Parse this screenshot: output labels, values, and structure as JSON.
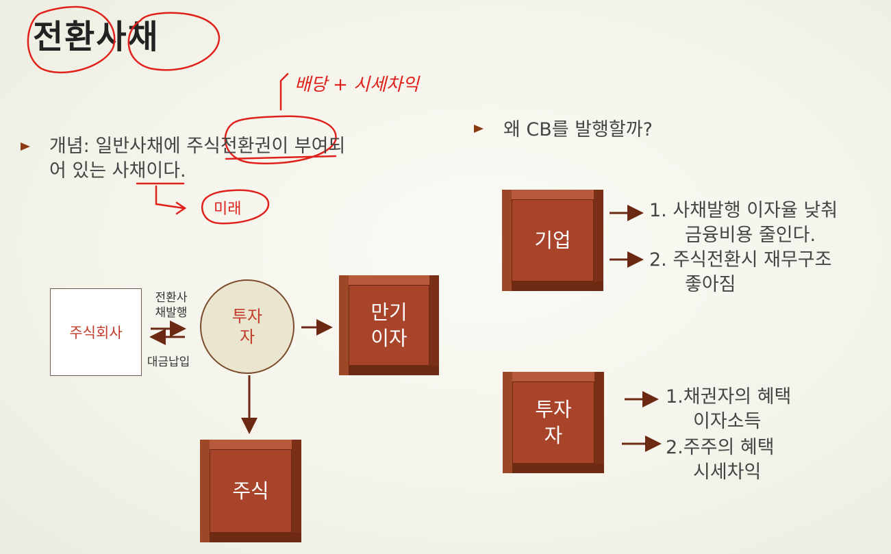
{
  "title": "전환사채",
  "annotations": {
    "top": "배당 + 시세차익",
    "bottom": "미래"
  },
  "left_bullet": {
    "line1": "개념: 일반사채에 주식전환권이 부여되",
    "line2": "어 있는 사채이다."
  },
  "right_bullet": "왜 CB를 발행할까?",
  "diagram": {
    "company": "주식회사",
    "issue_label_1": "전환사",
    "issue_label_2": "채발행",
    "payment_label": "대금납입",
    "investor_1": "투자",
    "investor_2": "자",
    "maturity_1": "만기",
    "maturity_2": "이자",
    "stock": "주식"
  },
  "corporate": {
    "box": "기업",
    "p1_line1": "1.  사채발행 이자율 낮춰",
    "p1_line2": "금융비용 줄인다.",
    "p2_line1": "2.  주식전환시 재무구조",
    "p2_line2": "좋아짐"
  },
  "investor": {
    "box_1": "투자",
    "box_2": "자",
    "b1_line1": "1.채권자의 혜택",
    "b1_line2": "이자소득",
    "b2_line1": "2.주주의 혜택",
    "b2_line2": "시세차익"
  },
  "colors": {
    "accent": "#8c3a12",
    "box": "#a8442a",
    "ink": "#e0201a"
  }
}
